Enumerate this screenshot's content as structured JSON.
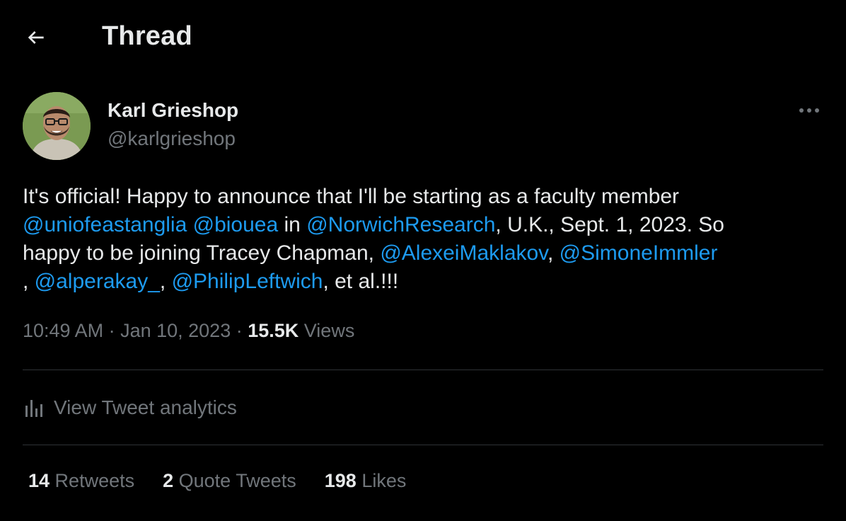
{
  "header": {
    "title": "Thread",
    "back_icon": "arrow-left-icon"
  },
  "tweet": {
    "author": {
      "name": "Karl Grieshop",
      "handle": "@karlgrieshop"
    },
    "more_icon": "more-dots-icon",
    "text": {
      "line1": {
        "t1": "It's official! Happy to announce that I'll be starting as a faculty member"
      },
      "line2": {
        "m1": "@uniofeastanglia",
        "t1": " ",
        "m2": "@biouea",
        "t2": " in ",
        "m3": "@NorwichResearch",
        "t3": ", U.K., Sept. 1, 2023. So"
      },
      "line3": {
        "t1": "happy to be joining Tracey Chapman, ",
        "m1": "@AlexeiMaklakov",
        "t2": ", ",
        "m2": "@SimoneImmler"
      },
      "line4": {
        "t1": ", ",
        "m1": "@alperakay_",
        "t2": ", ",
        "m2": "@PhilipLeftwich",
        "t3": ", et al.!!!"
      }
    },
    "time": "10:49 AM",
    "sep1": " · ",
    "date": "Jan 10, 2023",
    "sep2": " · ",
    "views_count": "15.5K",
    "views_label": " Views",
    "analytics_label": "View Tweet analytics",
    "analytics_icon": "bar-chart-icon",
    "stats": {
      "retweets_count": "14",
      "retweets_label": " Retweets",
      "quotes_count": "2",
      "quotes_label": " Quote Tweets",
      "likes_count": "198",
      "likes_label": " Likes"
    }
  },
  "colors": {
    "background": "#000000",
    "text": "#e7e9ea",
    "secondary": "#71767b",
    "link": "#1d9bf0",
    "divider": "#2f3336"
  }
}
